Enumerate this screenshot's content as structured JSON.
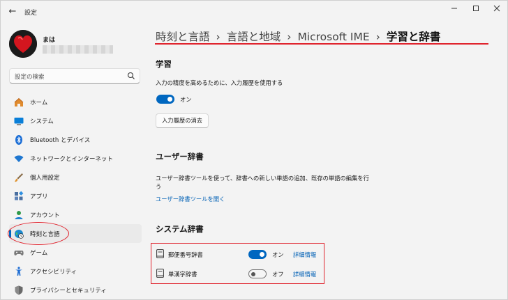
{
  "window": {
    "back_icon": "arrow-left-icon",
    "title": "設定",
    "controls": [
      "minimize",
      "maximize",
      "close"
    ]
  },
  "user": {
    "name": "まは",
    "email_redacted": true
  },
  "search": {
    "placeholder": "設定の検索",
    "icon": "search-icon"
  },
  "sidebar": {
    "items": [
      {
        "label": "ホーム",
        "icon": "home-icon",
        "color": "#d9731e"
      },
      {
        "label": "システム",
        "icon": "monitor-icon",
        "color": "#0a7fd8"
      },
      {
        "label": "Bluetooth とデバイス",
        "icon": "bluetooth-icon",
        "color": "#1d6fd6"
      },
      {
        "label": "ネットワークとインターネット",
        "icon": "wifi-icon",
        "color": "#1f77d0"
      },
      {
        "label": "個人用設定",
        "icon": "brush-icon",
        "color": "#d08a2c"
      },
      {
        "label": "アプリ",
        "icon": "apps-icon",
        "color": "#4a6fa0"
      },
      {
        "label": "アカウント",
        "icon": "person-icon",
        "color": "#2e9a4a"
      },
      {
        "label": "時刻と言語",
        "icon": "globe-clock-icon",
        "color": "#1b8ad0",
        "active": true
      },
      {
        "label": "ゲーム",
        "icon": "gamepad-icon",
        "color": "#6b6b6b"
      },
      {
        "label": "アクセシビリティ",
        "icon": "accessibility-icon",
        "color": "#1f6ed4"
      },
      {
        "label": "プライバシーとセキュリティ",
        "icon": "shield-icon",
        "color": "#6a6a6a"
      }
    ]
  },
  "breadcrumb": {
    "items": [
      "時刻と言語",
      "言語と地域",
      "Microsoft IME"
    ],
    "separator": "›",
    "current": "学習と辞書"
  },
  "learning": {
    "title": "学習",
    "description": "入力の精度を高めるために、入力履歴を使用する",
    "toggle_state": "オン",
    "clear_button": "入力履歴の消去"
  },
  "user_dictionary": {
    "title": "ユーザー辞書",
    "description_line1": "ユーザー辞書ツールを使って、辞書への新しい単語の追加、既存の単語の編集を行",
    "description_line2": "う",
    "open_link": "ユーザー辞書ツールを開く"
  },
  "system_dictionary": {
    "title": "システム辞書",
    "items": [
      {
        "label": "郵便番号辞書",
        "state": "オン",
        "on": true,
        "details": "詳細情報"
      },
      {
        "label": "単漢字辞書",
        "state": "オフ",
        "on": false,
        "details": "詳細情報"
      }
    ]
  },
  "colors": {
    "accent": "#0067c0",
    "annotation_red": "#e0232d",
    "link": "#0060b5"
  }
}
